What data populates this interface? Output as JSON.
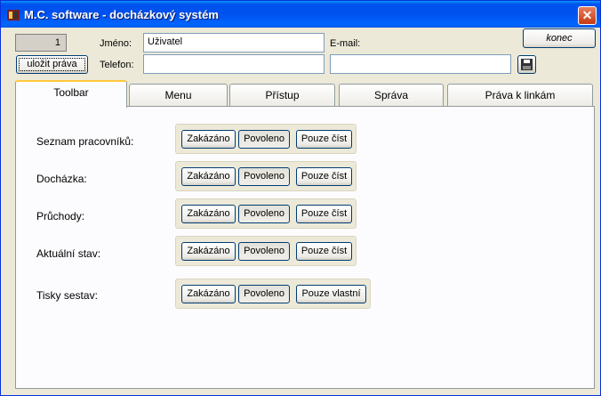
{
  "window": {
    "title": "M.C. software - docházkový systém",
    "close_glyph": "✕"
  },
  "header": {
    "counter_value": "1",
    "save_rights_label": "uložit práva",
    "name_label": "Jméno:",
    "name_value": "Uživatel",
    "phone_label": "Telefon:",
    "phone_value": "",
    "email_label": "E-mail:",
    "email_value": "",
    "exit_label": "konec",
    "save_icon": "floppy-disk-icon"
  },
  "tabs": [
    {
      "label": "Toolbar",
      "active": true
    },
    {
      "label": "Menu"
    },
    {
      "label": "Přístup"
    },
    {
      "label": "Správa"
    },
    {
      "label": "Práva k linkám"
    }
  ],
  "permissions": [
    {
      "label": "Seznam pracovníků:",
      "options": [
        "Zakázáno",
        "Povoleno",
        "Pouze číst"
      ],
      "selected": "Povoleno"
    },
    {
      "label": "Docházka:",
      "options": [
        "Zakázáno",
        "Povoleno",
        "Pouze číst"
      ],
      "selected": "Povoleno"
    },
    {
      "label": "Průchody:",
      "options": [
        "Zakázáno",
        "Povoleno",
        "Pouze číst"
      ],
      "selected": "Povoleno"
    },
    {
      "label": "Aktuální stav:",
      "options": [
        "Zakázáno",
        "Povoleno",
        "Pouze číst"
      ],
      "selected": "Povoleno"
    },
    {
      "label": "Tisky sestav:",
      "options": [
        "Zakázáno",
        "Povoleno",
        "Pouze vlastní"
      ],
      "selected": "Povoleno"
    }
  ],
  "colors": {
    "titlebar": "#0053EE",
    "tab_accent": "#FFC83C",
    "face": "#ECE9D8"
  }
}
